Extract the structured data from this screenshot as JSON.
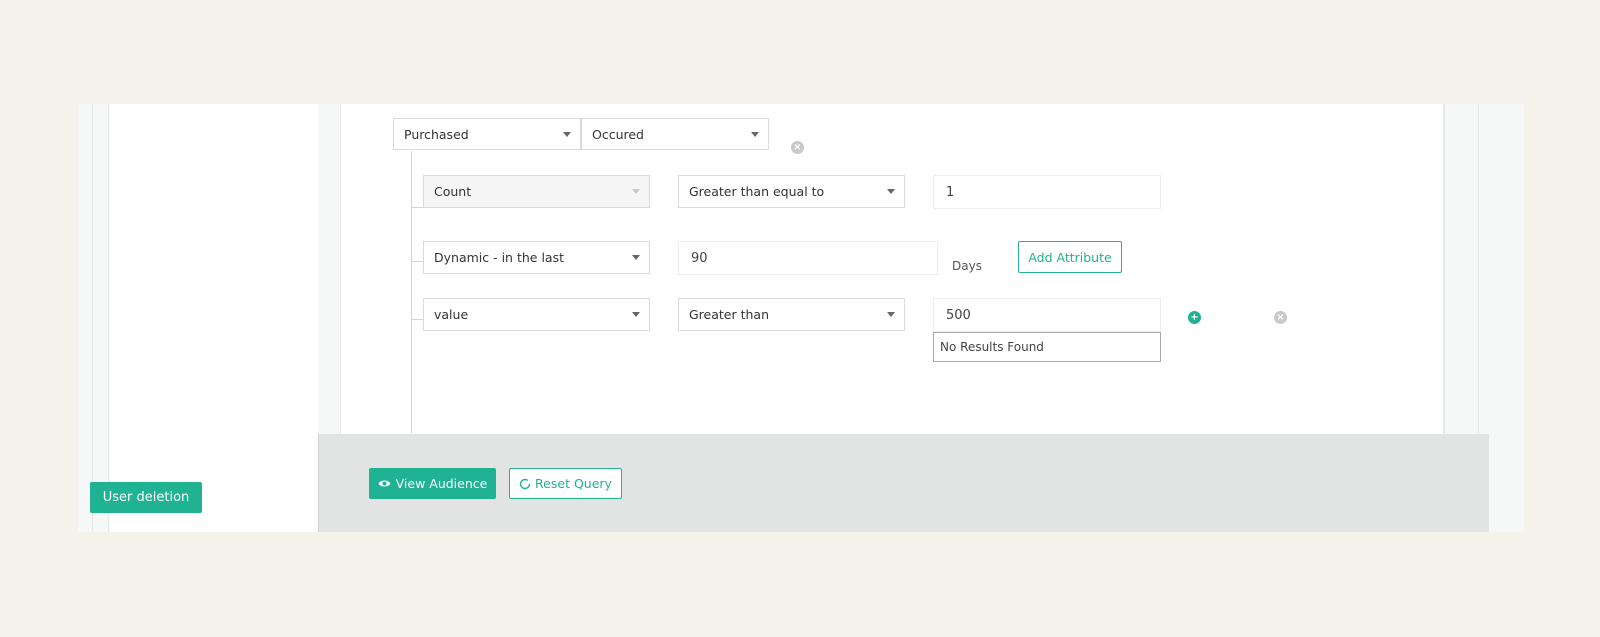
{
  "sidebar": {
    "user_deletion_label": "User deletion"
  },
  "event_row": {
    "event_select": "Purchased",
    "condition_select": "Occured",
    "remove_icon": "close-circle-icon"
  },
  "filters": [
    {
      "attribute": "Count",
      "operator": "Greater than equal to",
      "value": "1",
      "disabled": true
    },
    {
      "attribute": "Dynamic - in the last",
      "value": "90",
      "unit": "Days",
      "add_attribute_label": "Add Attribute"
    },
    {
      "attribute": "value",
      "operator": "Greater than",
      "value": "500",
      "suggestion": "No Results Found",
      "add_icon": "plus-circle-icon",
      "remove_icon": "close-circle-icon"
    }
  ],
  "footer": {
    "view_audience_label": "View Audience",
    "reset_query_label": "Reset Query"
  },
  "colors": {
    "accent": "#1fb293",
    "background": "#f4f2ea",
    "footer": "#e2e4e3"
  }
}
